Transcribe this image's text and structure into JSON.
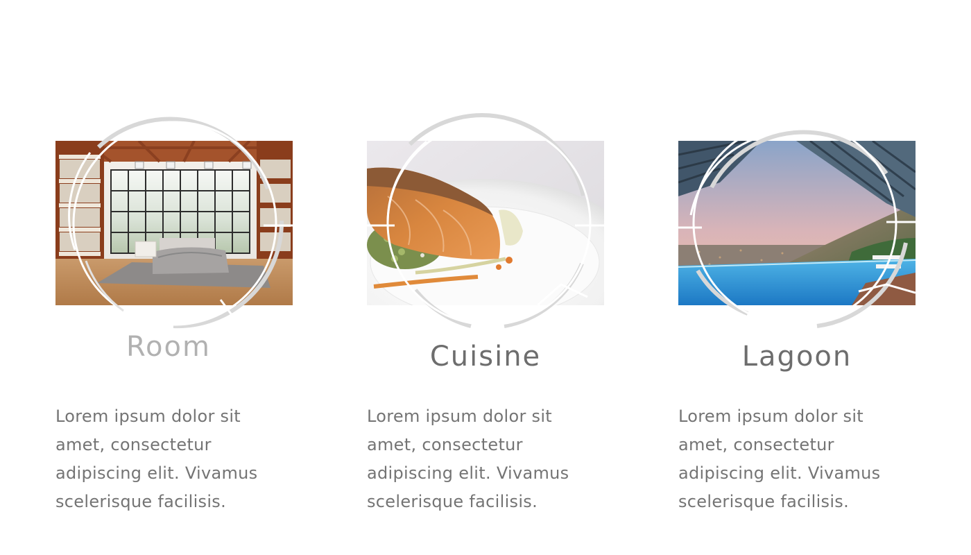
{
  "cards": [
    {
      "title": "Room",
      "description": "Lorem ipsum dolor sit amet, consectetur adipiscing elit. Vivamus scelerisque facilisis.",
      "image": "bedroom-library-photo"
    },
    {
      "title": "Cuisine",
      "description": "Lorem ipsum dolor sit amet, consectetur adipiscing elit. Vivamus scelerisque facilisis.",
      "image": "salmon-dish-photo"
    },
    {
      "title": "Lagoon",
      "description": "Lorem ipsum dolor sit amet, consectetur adipiscing elit. Vivamus scelerisque facilisis.",
      "image": "infinity-pool-photo"
    }
  ],
  "colors": {
    "ring": "#d6d6d6",
    "title_muted": "#b1b1b1",
    "title": "#6d6d6d",
    "body_text": "#747474"
  }
}
